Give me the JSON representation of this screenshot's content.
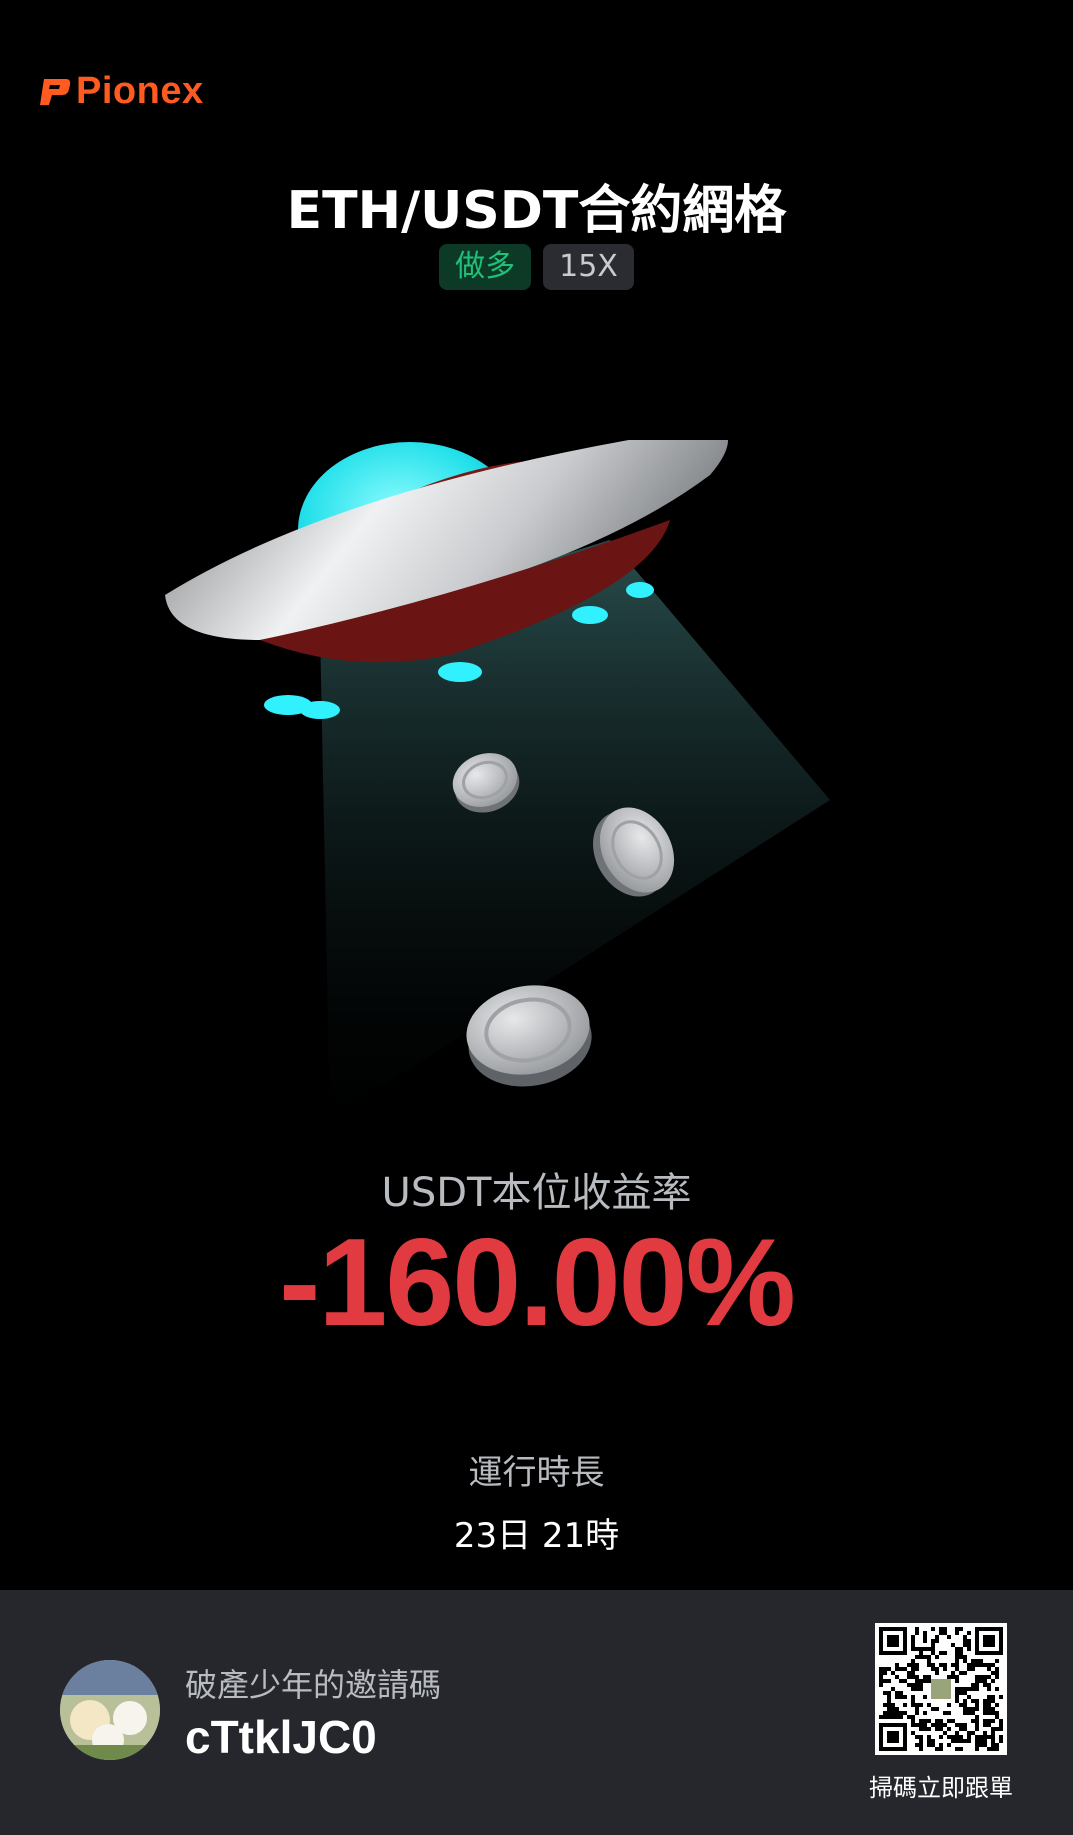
{
  "brand": {
    "name": "Pionex",
    "color": "#ff5a1f"
  },
  "title": "ETH/USDT合約網格",
  "badges": {
    "direction": "做多",
    "leverage": "15X"
  },
  "metric": {
    "label": "USDT本位收益率",
    "value": "-160.00%",
    "color": "#e13b41"
  },
  "runtime": {
    "label": "運行時長",
    "value": "23日 21時"
  },
  "footer": {
    "invite_label": "破產少年的邀請碼",
    "invite_code": "cTtklJC0",
    "qr_caption": "掃碼立即跟單"
  },
  "icons": {
    "logo": "pionex-logo-icon",
    "illustration": "ufo-coins-illustration",
    "avatar": "user-avatar",
    "qr": "qr-code-icon"
  }
}
